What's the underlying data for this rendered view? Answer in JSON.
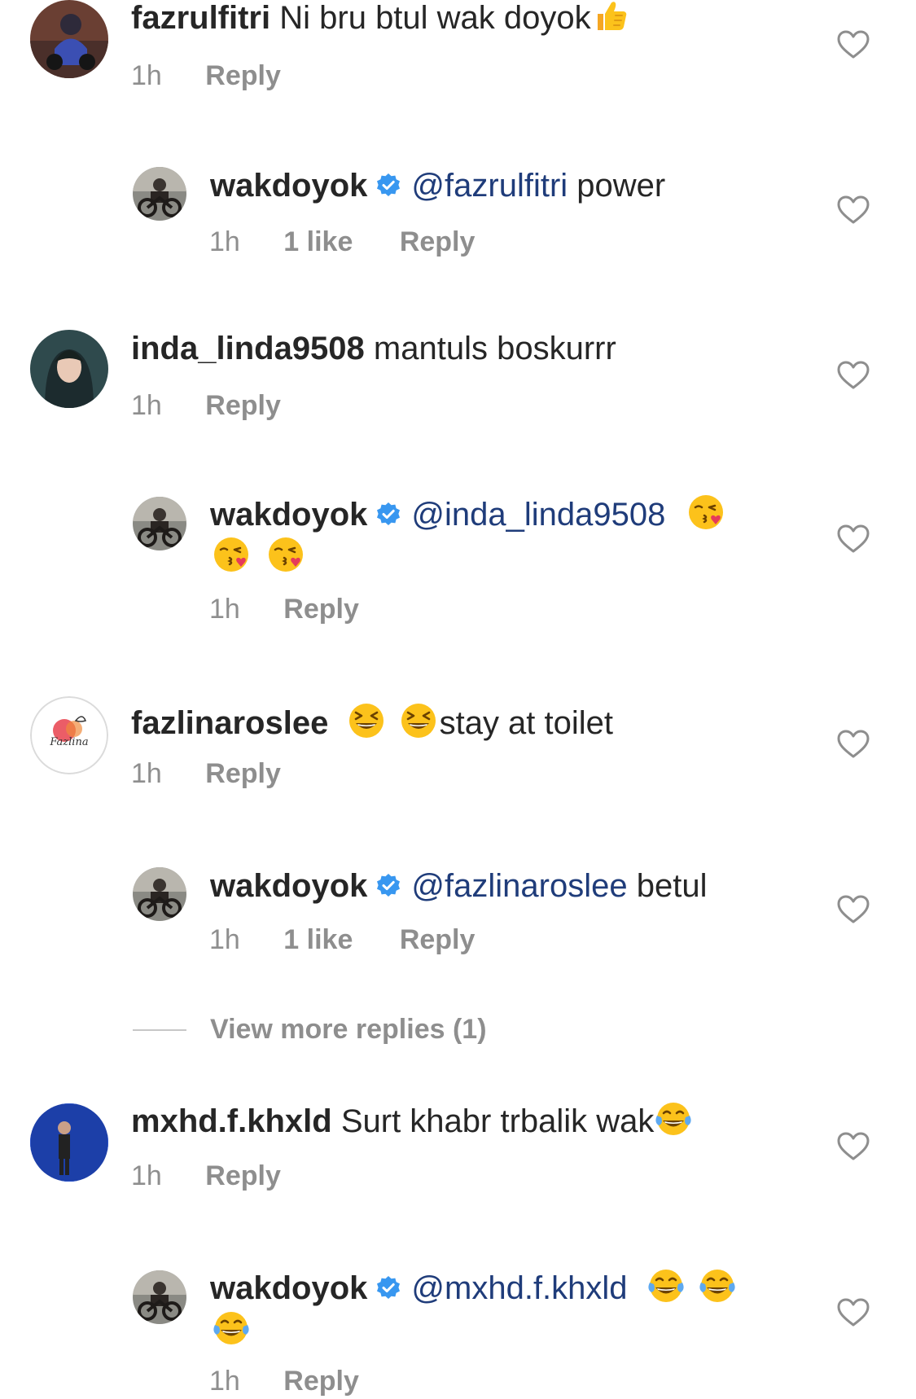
{
  "colors": {
    "text": "#262626",
    "meta": "#8e8e8e",
    "mention": "#1f3c7a",
    "verified": "#3897f0",
    "divider": "#c7c7c7"
  },
  "comments": [
    {
      "username": "fazrulfitri",
      "text": "Ni bru btul wak doyok",
      "emoji": "thumbs-up",
      "time": "1h",
      "reply_label": "Reply",
      "replies": [
        {
          "username": "wakdoyok",
          "verified": true,
          "mention": "@fazrulfitri",
          "text": "power",
          "time": "1h",
          "likes": "1 like",
          "reply_label": "Reply"
        }
      ]
    },
    {
      "username": "inda_linda9508",
      "text": "mantuls boskurrr",
      "time": "1h",
      "reply_label": "Reply",
      "replies": [
        {
          "username": "wakdoyok",
          "verified": true,
          "mention": "@inda_linda9508",
          "emojis": [
            "face-blowing-kiss",
            "face-blowing-kiss",
            "face-blowing-kiss"
          ],
          "time": "1h",
          "reply_label": "Reply"
        }
      ]
    },
    {
      "username": "fazlinaroslee",
      "emojis": [
        "grinning-squinting-face",
        "grinning-squinting-face"
      ],
      "text": "stay at toilet",
      "time": "1h",
      "reply_label": "Reply",
      "replies": [
        {
          "username": "wakdoyok",
          "verified": true,
          "mention": "@fazlinaroslee",
          "text": "betul",
          "time": "1h",
          "likes": "1 like",
          "reply_label": "Reply"
        }
      ],
      "view_more_replies": "View more replies (1)"
    },
    {
      "username": "mxhd.f.khxld",
      "text": "Surt khabr trbalik wak",
      "emoji": "face-with-tears-of-joy",
      "time": "1h",
      "reply_label": "Reply",
      "replies": [
        {
          "username": "wakdoyok",
          "verified": true,
          "mention": "@mxhd.f.khxld",
          "emojis": [
            "face-with-tears-of-joy",
            "face-with-tears-of-joy",
            "face-with-tears-of-joy"
          ],
          "time": "1h",
          "reply_label": "Reply"
        }
      ]
    }
  ]
}
